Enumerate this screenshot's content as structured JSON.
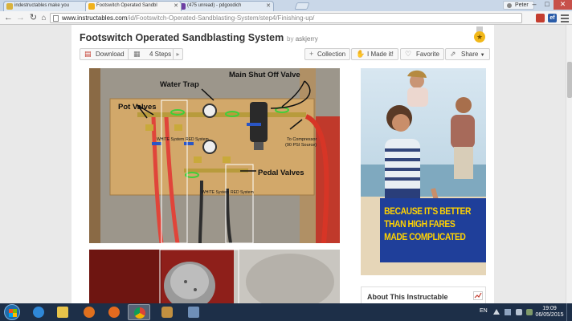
{
  "browser": {
    "tabs": [
      {
        "label": "indestructables make you",
        "active": false,
        "favicon_color": "#d9b23c"
      },
      {
        "label": "Footswitch Operated Sandbl",
        "active": true,
        "favicon_color": "#f0b11b"
      },
      {
        "label": "(475 unread) - pdgoodich",
        "active": false,
        "favicon_color": "#6e3fa3"
      }
    ],
    "profile": "Peter",
    "window_controls": {
      "minimize": "–",
      "maximize": "□",
      "close": "✕"
    },
    "url_host": "www.instructables.com",
    "url_path": "/id/Footswitch-Operated-Sandblasting-System/step4/Finishing-up/",
    "extensions": [
      {
        "name": "extension-red",
        "color": "#c43d2f",
        "glyph": ""
      },
      {
        "name": "extension-blue",
        "color": "#2a5ca8",
        "glyph": "ef"
      }
    ]
  },
  "project": {
    "title": "Footswitch Operated Sandblasting System",
    "author_prefix": "by",
    "author": "askjerry"
  },
  "actions": {
    "download": "Download",
    "steps": "4 Steps",
    "collection": "Collection",
    "made_it": "I Made it!",
    "favorite": "Favorite",
    "share": "Share"
  },
  "figure": {
    "labels": {
      "main_shutoff": "Main Shut Off Valve",
      "water_trap": "Water Trap",
      "pot_valves": "Pot Valves",
      "pedal_valves": "Pedal Valves",
      "to_compressor_1": "To Compressor",
      "to_compressor_2": "(90 PSI Source)",
      "white_system": "WHITE System",
      "red_system": "RED System",
      "white_system_2": "WHITE System",
      "red_system_2": "RED System"
    }
  },
  "ad": {
    "line1": "BECAUSE IT'S BETTER",
    "line2": "THAN HIGH FARES",
    "line3": "MADE COMPLICATED",
    "panel_color": "#1f3f9a",
    "text_color": "#ffd200"
  },
  "sidebar": {
    "about_title": "About This Instructable"
  },
  "taskbar": {
    "language": "EN",
    "time": "19:09",
    "date": "06/05/2015"
  }
}
